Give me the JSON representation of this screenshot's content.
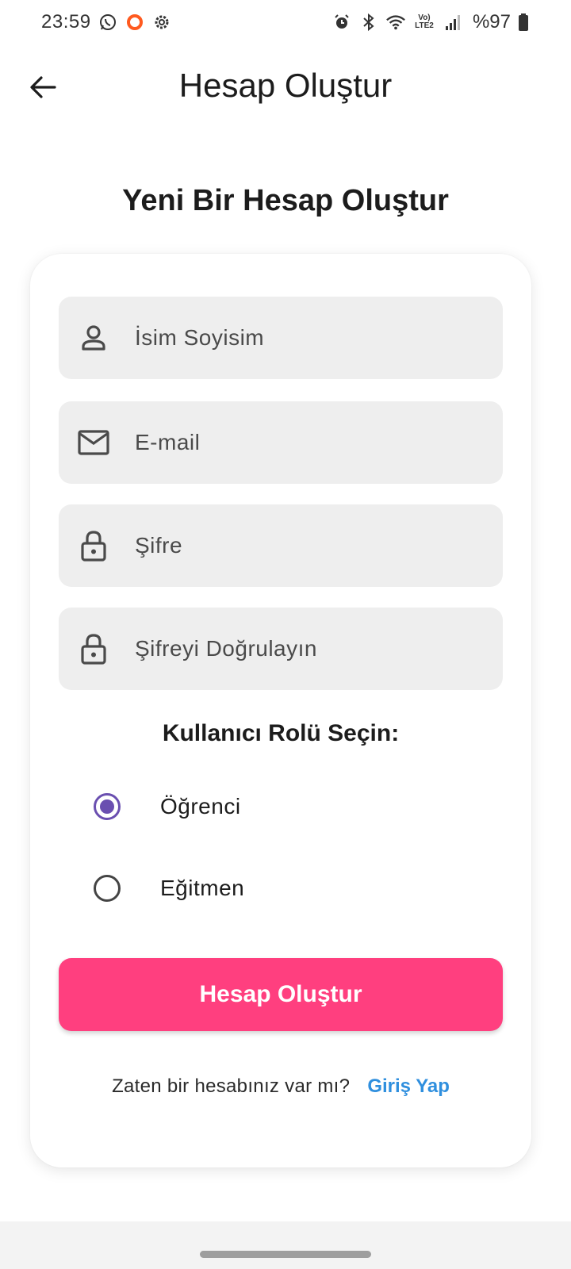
{
  "status_bar": {
    "time": "23:59",
    "battery": "%97",
    "left_icons": [
      "whatsapp-icon",
      "circle-app-icon",
      "gear-icon"
    ],
    "right_icons": [
      "alarm-icon",
      "bluetooth-icon",
      "wifi-icon",
      "volte-lte2-icon",
      "signal-icon",
      "battery-icon"
    ],
    "volte_top": "Vo)",
    "volte_bottom": "LTE2"
  },
  "app_bar": {
    "back_icon": "arrow-left-icon",
    "title": "Hesap Oluştur"
  },
  "heading": "Yeni Bir Hesap Oluştur",
  "form": {
    "fields": [
      {
        "icon": "person-icon",
        "placeholder": "İsim Soyisim",
        "value": ""
      },
      {
        "icon": "mail-icon",
        "placeholder": "E-mail",
        "value": ""
      },
      {
        "icon": "lock-icon",
        "placeholder": "Şifre",
        "value": ""
      },
      {
        "icon": "lock-icon",
        "placeholder": "Şifreyi Doğrulayın",
        "value": ""
      }
    ],
    "role_title": "Kullanıcı Rolü Seçin:",
    "roles": [
      {
        "label": "Öğrenci",
        "selected": true
      },
      {
        "label": "Eğitmen",
        "selected": false
      }
    ],
    "submit_label": "Hesap Oluştur",
    "login_question": "Zaten bir hesabınız var mı?",
    "login_link": "Giriş Yap"
  },
  "colors": {
    "accent_pink": "#ff3f7f",
    "radio_purple": "#6a4fb0",
    "link_blue": "#2f8fde",
    "field_bg": "#eeeeee"
  }
}
